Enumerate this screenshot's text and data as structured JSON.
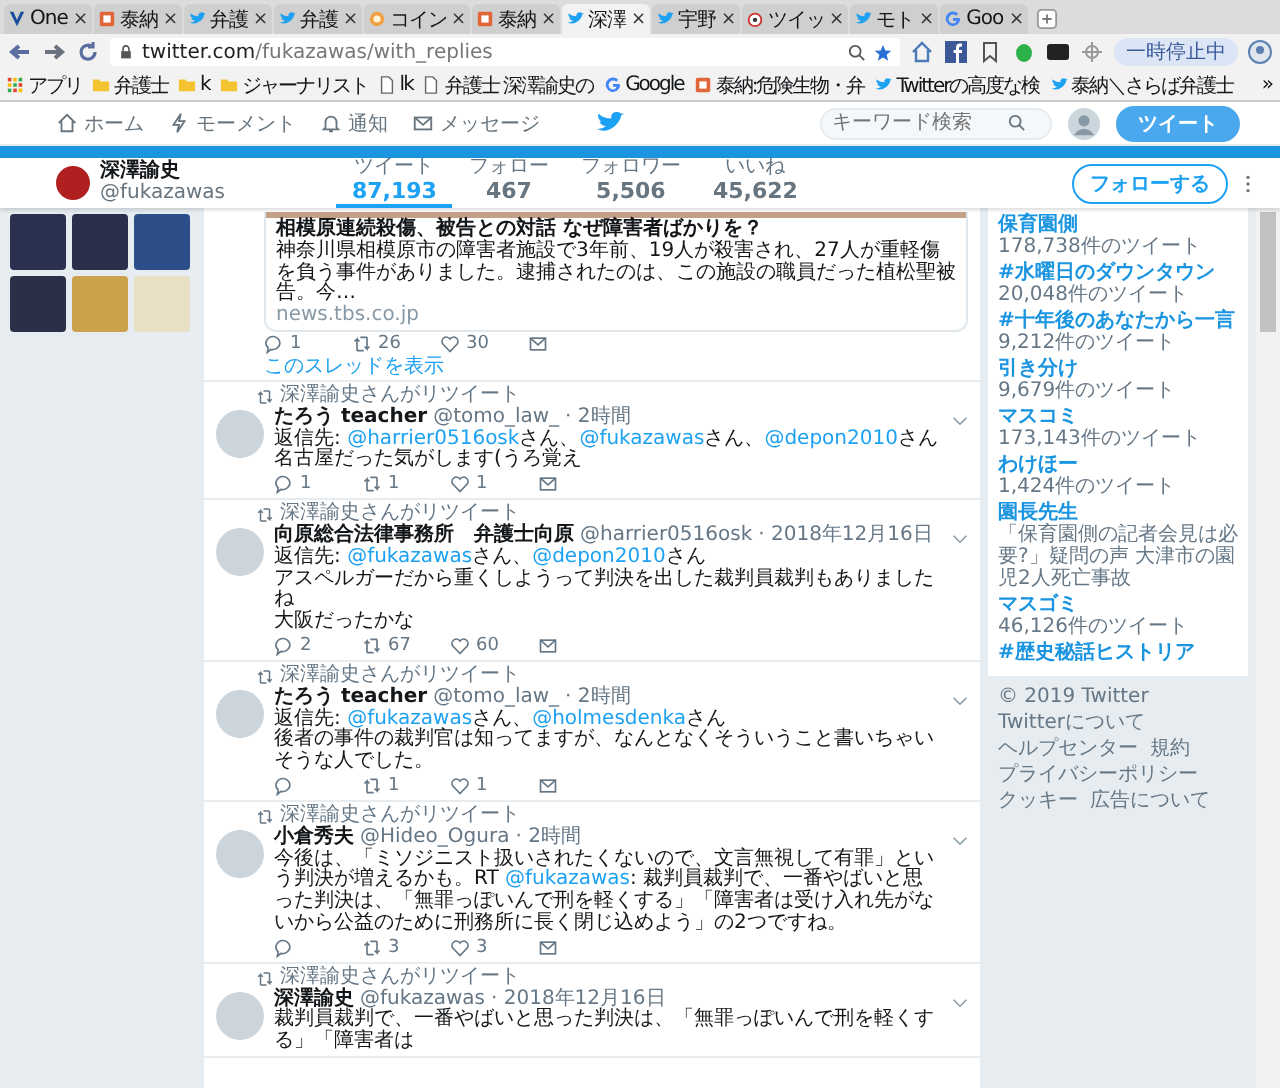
{
  "browser": {
    "tabs": [
      {
        "label": "One",
        "kind": "v",
        "close": "×",
        "selected": false
      },
      {
        "label": "泰納",
        "kind": "box",
        "close": "×",
        "selected": false
      },
      {
        "label": "弁護",
        "kind": "bird",
        "close": "×",
        "selected": false
      },
      {
        "label": "弁護",
        "kind": "bird",
        "close": "×",
        "selected": false
      },
      {
        "label": "コイン",
        "kind": "coin",
        "close": "×",
        "selected": false
      },
      {
        "label": "泰納",
        "kind": "box",
        "close": "×",
        "selected": false
      },
      {
        "label": "深澤",
        "kind": "bird",
        "close": "×",
        "selected": true
      },
      {
        "label": "宇野",
        "kind": "bird",
        "close": "×",
        "selected": false
      },
      {
        "label": "ツイッ",
        "kind": "dog",
        "close": "×",
        "selected": false
      },
      {
        "label": "モト",
        "kind": "bird",
        "close": "×",
        "selected": false
      },
      {
        "label": "Goo",
        "kind": "g",
        "close": "×",
        "selected": false
      }
    ],
    "address": {
      "host": "twitter.com",
      "path": "/fukazawas/with_replies"
    },
    "paused_label": "一時停止中",
    "bookmarks": [
      {
        "label": "アプリ",
        "kind": "apps"
      },
      {
        "label": "弁護士",
        "kind": "folder"
      },
      {
        "label": "k",
        "kind": "folder"
      },
      {
        "label": "ジャーナリスト",
        "kind": "folder"
      },
      {
        "label": "lk",
        "kind": "page"
      },
      {
        "label": "弁護士 深澤諭史の",
        "kind": "page"
      },
      {
        "label": "Google",
        "kind": "g"
      },
      {
        "label": "泰納:危険生物・弁",
        "kind": "box"
      },
      {
        "label": "Twitterの高度な検",
        "kind": "bird"
      },
      {
        "label": "泰納＼さらば弁護士",
        "kind": "bird"
      }
    ],
    "bookmarks_more": "»"
  },
  "nav": {
    "items": [
      {
        "label": "ホーム",
        "kind": "home"
      },
      {
        "label": "モーメント",
        "kind": "bolt"
      },
      {
        "label": "通知",
        "kind": "bell"
      },
      {
        "label": "メッセージ",
        "kind": "mail"
      }
    ],
    "search_placeholder": "キーワード検索",
    "tweet_button": "ツイート"
  },
  "profile": {
    "name": "深澤諭史",
    "handle": "@fukazawas",
    "follow_button": "フォローする",
    "stats": [
      {
        "label": "ツイート",
        "value": "87,193",
        "selected": true
      },
      {
        "label": "フォロー",
        "value": "467",
        "selected": false
      },
      {
        "label": "フォロワー",
        "value": "5,506",
        "selected": false
      },
      {
        "label": "いいね",
        "value": "45,622",
        "selected": false
      }
    ]
  },
  "card": {
    "title": "相模原連続殺傷、被告との対話 なぜ障害者ばかりを？",
    "description": "神奈川県相模原市の障害者施設で3年前、19人が殺害され、27人が重軽傷を負う事件がありました。逮捕されたのは、この施設の職員だった植松聖被告。今…",
    "domain": "news.tbs.co.jp",
    "actions": [
      {
        "kind": "reply",
        "count": "1"
      },
      {
        "kind": "retweet",
        "count": "26"
      },
      {
        "kind": "like",
        "count": "30"
      },
      {
        "kind": "dm"
      }
    ],
    "show_thread": "このスレッドを表示"
  },
  "tweets": [
    {
      "retweeted_by": "深澤諭史さんがリツイート",
      "name": "たろう teacher",
      "handle": "@tomo_law_",
      "time": "· 2時間",
      "reply_to": [
        {
          "t": "返信先: ",
          "kind": "text"
        },
        {
          "t": "@harrier0516osk",
          "kind": "mention"
        },
        {
          "t": "さん、",
          "kind": "text"
        },
        {
          "t": "@fukazawas",
          "kind": "mention"
        },
        {
          "t": "さん、",
          "kind": "text"
        },
        {
          "t": "@depon2010",
          "kind": "mention"
        },
        {
          "t": "さん",
          "kind": "text"
        }
      ],
      "paragraphs": [
        [
          {
            "t": "名古屋だった気がします(うろ覚え",
            "kind": "text"
          }
        ]
      ],
      "actions": [
        {
          "kind": "reply",
          "count": "1"
        },
        {
          "kind": "retweet",
          "count": "1"
        },
        {
          "kind": "like",
          "count": "1"
        },
        {
          "kind": "dm"
        }
      ]
    },
    {
      "retweeted_by": "深澤諭史さんがリツイート",
      "name": "向原総合法律事務所　弁護士向原",
      "handle": "@harrier0516osk",
      "time": "· 2018年12月16日",
      "reply_to": [
        {
          "t": "返信先: ",
          "kind": "text"
        },
        {
          "t": "@fukazawas",
          "kind": "mention"
        },
        {
          "t": "さん、",
          "kind": "text"
        },
        {
          "t": "@depon2010",
          "kind": "mention"
        },
        {
          "t": "さん",
          "kind": "text"
        }
      ],
      "paragraphs": [
        [
          {
            "t": "アスペルガーだから重くしようって判決を出した裁判員裁判もありましたね",
            "kind": "text"
          }
        ],
        [
          {
            "t": "大阪だったかな",
            "kind": "text"
          }
        ]
      ],
      "actions": [
        {
          "kind": "reply",
          "count": "2"
        },
        {
          "kind": "retweet",
          "count": "67"
        },
        {
          "kind": "like",
          "count": "60"
        },
        {
          "kind": "dm"
        }
      ]
    },
    {
      "retweeted_by": "深澤諭史さんがリツイート",
      "name": "たろう teacher",
      "handle": "@tomo_law_",
      "time": "· 2時間",
      "reply_to": [
        {
          "t": "返信先: ",
          "kind": "text"
        },
        {
          "t": "@fukazawas",
          "kind": "mention"
        },
        {
          "t": "さん、",
          "kind": "text"
        },
        {
          "t": "@holmesdenka",
          "kind": "mention"
        },
        {
          "t": "さん",
          "kind": "text"
        }
      ],
      "paragraphs": [
        [
          {
            "t": "後者の事件の裁判官は知ってますが、なんとなくそういうこと書いちゃいそうな人でした。",
            "kind": "text"
          }
        ]
      ],
      "actions": [
        {
          "kind": "reply"
        },
        {
          "kind": "retweet",
          "count": "1"
        },
        {
          "kind": "like",
          "count": "1"
        },
        {
          "kind": "dm"
        }
      ]
    },
    {
      "retweeted_by": "深澤諭史さんがリツイート",
      "name": "小倉秀夫",
      "handle": "@Hideo_Ogura",
      "time": "· 2時間",
      "paragraphs": [
        [
          {
            "t": "今後は、「ミソジニスト扱いされたくないので、文言無視して有罪」という判決が増えるかも。RT ",
            "kind": "text"
          },
          {
            "t": "@fukazawas",
            "kind": "mention"
          },
          {
            "t": ": 裁判員裁判で、一番やばいと思った判決は、「無罪っぽいんで刑を軽くする」「障害者は受け入れ先がないから公益のために刑務所に長く閉じ込めよう」の2つですね。",
            "kind": "text"
          }
        ]
      ],
      "actions": [
        {
          "kind": "reply"
        },
        {
          "kind": "retweet",
          "count": "3"
        },
        {
          "kind": "like",
          "count": "3"
        },
        {
          "kind": "dm"
        }
      ]
    },
    {
      "retweeted_by": "深澤諭史さんがリツイート",
      "name": "深澤諭史",
      "handle": "@fukazawas",
      "time": "· 2018年12月16日",
      "paragraphs": [
        [
          {
            "t": "裁判員裁判で、一番やばいと思った判決は、「無罪っぽいんで刑を軽くする」「障害者は",
            "kind": "text"
          }
        ]
      ]
    }
  ],
  "trends": [
    {
      "name": "保育園側",
      "meta": "178,738件のツイート"
    },
    {
      "name": "#水曜日のダウンタウン",
      "meta": "20,048件のツイート"
    },
    {
      "name": "#十年後のあなたから一言",
      "meta": "9,212件のツイート"
    },
    {
      "name": "引き分け",
      "meta": "9,679件のツイート"
    },
    {
      "name": "マスコミ",
      "meta": "173,143件のツイート"
    },
    {
      "name": "わけほー",
      "meta": "1,424件のツイート"
    },
    {
      "name": "園長先生",
      "meta": "「保育園側の記者会見は必要?」疑問の声 大津市の園児2人死亡事故"
    },
    {
      "name": "マスゴミ",
      "meta": "46,126件のツイート"
    },
    {
      "name": "#歴史秘話ヒストリア"
    }
  ],
  "footer_links": [
    "© 2019 Twitter",
    "Twitterについて",
    "ヘルプセンター",
    "規約",
    "プライバシーポリシー",
    "クッキー",
    "広告について"
  ]
}
